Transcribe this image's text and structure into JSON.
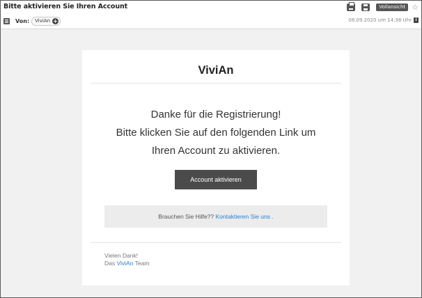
{
  "header": {
    "subject": "Bitte aktivieren Sie Ihren Account",
    "from_label": "Von:",
    "sender": "ViviAn",
    "fullview_label": "Vollansicht",
    "date": "08.09.2020 um 14:38 Uhr"
  },
  "email": {
    "logo": "ViviAn",
    "message_lines": [
      "Danke für die Registrierung!",
      "Bitte klicken Sie auf den folgenden Link um",
      "Ihren Account zu aktivieren."
    ],
    "cta_label": "Account aktivieren",
    "help_text": "Brauchen Sie Hilfe??",
    "help_link": "Kontaktieren Sie uns",
    "help_suffix": " .",
    "thanks": "Vielen Dank!",
    "team_prefix": "Das",
    "team_brand": "ViviAn",
    "team_suffix": "Team"
  },
  "icons": {
    "menu": "menu-icon",
    "add_contact": "plus-circle-icon",
    "print": "printer-icon",
    "save": "floppy-disk-icon",
    "favorite": "star-icon",
    "info": "info-icon"
  },
  "colors": {
    "link": "#2a7fd4",
    "cta_background": "#4b4b4b",
    "page_background": "#f1f1f1"
  }
}
